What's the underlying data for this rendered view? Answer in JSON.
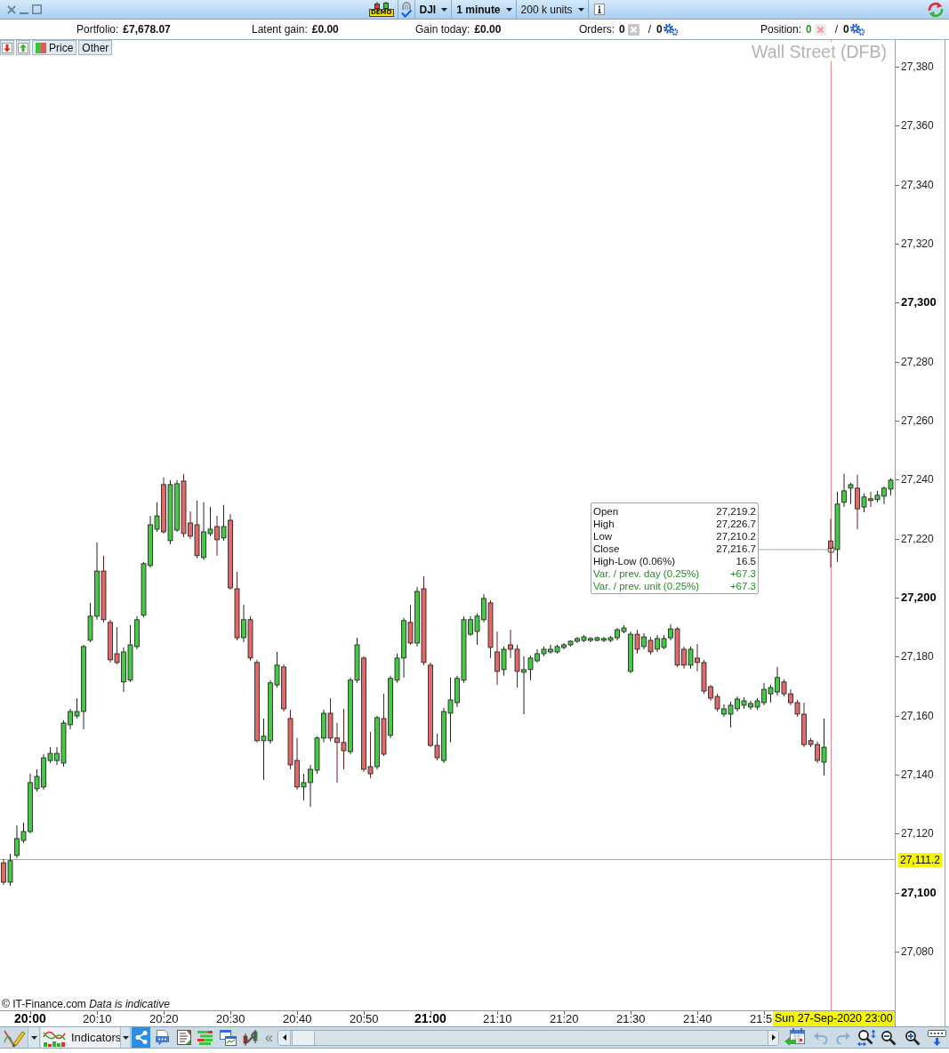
{
  "title_bar": {
    "account_badge": "DEMO",
    "instrument": "DJI",
    "interval": "1 minute",
    "trade_size": "200 k units"
  },
  "summary_bar": {
    "figures": [
      {
        "label": "Portfolio:",
        "value": "£7,678.07"
      },
      {
        "label": "Latent gain:",
        "value": "£0.00"
      },
      {
        "label": "Gain today:",
        "value": "£0.00"
      }
    ],
    "orders": {
      "label": "Orders:",
      "count": "0",
      "separator": "/",
      "pending": "0"
    },
    "position": {
      "label": "Position:",
      "count": "0",
      "separator": "/",
      "pending": "0"
    }
  },
  "chart": {
    "tabs": [
      {
        "label": "Price"
      },
      {
        "label": "Other"
      }
    ],
    "instrument_name": "Wall Street (DFB)",
    "chart_data": {
      "type": "candlestick",
      "ylim": [
        27060.1,
        27389.0
      ],
      "yticks": [
        {
          "value": 27380,
          "label": "27,380"
        },
        {
          "value": 27360,
          "label": "27,360"
        },
        {
          "value": 27340,
          "label": "27,340"
        },
        {
          "value": 27320,
          "label": "27,320"
        },
        {
          "value": 27300,
          "label": "27,300"
        },
        {
          "value": 27280,
          "label": "27,280"
        },
        {
          "value": 27260,
          "label": "27,260"
        },
        {
          "value": 27240,
          "label": "27,240"
        },
        {
          "value": 27220,
          "label": "27,220"
        },
        {
          "value": 27200,
          "label": "27,200"
        },
        {
          "value": 27180,
          "label": "27,180"
        },
        {
          "value": 27160,
          "label": "27,160"
        },
        {
          "value": 27140,
          "label": "27,140"
        },
        {
          "value": 27120,
          "label": "27,120"
        },
        {
          "value": 27100,
          "label": "27,100"
        },
        {
          "value": 27080,
          "label": "27,080"
        }
      ],
      "ref_lines": [
        {
          "axis": "y",
          "value": 27111.2,
          "label": "27,111.2"
        }
      ],
      "categories": [
        null,
        null,
        null,
        null,
        "20:00",
        null,
        null,
        null,
        null,
        null,
        null,
        null,
        null,
        null,
        "20:10",
        null,
        null,
        null,
        null,
        null,
        null,
        null,
        null,
        null,
        "20:20",
        null,
        null,
        null,
        null,
        null,
        null,
        null,
        null,
        null,
        "20:30",
        null,
        null,
        null,
        null,
        null,
        null,
        null,
        null,
        null,
        "20:40",
        null,
        null,
        null,
        null,
        null,
        null,
        null,
        null,
        null,
        "20:50",
        null,
        null,
        null,
        null,
        null,
        null,
        null,
        null,
        null,
        "21:00",
        null,
        null,
        null,
        null,
        null,
        null,
        null,
        null,
        null,
        "21:10",
        null,
        null,
        null,
        null,
        null,
        null,
        null,
        null,
        null,
        "21:20",
        null,
        null,
        null,
        null,
        null,
        null,
        null,
        null,
        null,
        "21:30",
        null,
        null,
        null,
        null,
        null,
        null,
        null,
        null,
        null,
        "21:40",
        null,
        null,
        null,
        null,
        null,
        null,
        null,
        null,
        null,
        "21:5",
        null,
        null,
        null,
        null,
        null,
        null,
        null,
        null,
        null,
        null,
        null,
        null,
        null,
        null,
        null,
        null,
        null,
        null,
        null
      ],
      "ohlc": [
        [
          27110.1,
          27111.4,
          27102.6,
          27103.5
        ],
        [
          27103.5,
          27113.2,
          27102.3,
          27110.8
        ],
        [
          27112.6,
          27122.8,
          27111.7,
          27118.3
        ],
        [
          27117.7,
          27123.7,
          27116.8,
          27120.7
        ],
        [
          27120.7,
          27140.3,
          27120.1,
          27137.3
        ],
        [
          27135.2,
          27141.8,
          27134.3,
          27139.4
        ],
        [
          27135.8,
          27146.9,
          27134.9,
          27145.7
        ],
        [
          27144.8,
          27149.3,
          27143.9,
          27147.2
        ],
        [
          27144.8,
          27149.3,
          27143.3,
          27147.2
        ],
        [
          27143.9,
          27158.4,
          27142.7,
          27157.5
        ],
        [
          27156.9,
          27162.3,
          27155.4,
          27161.4
        ],
        [
          27159.9,
          27165.9,
          27159.0,
          27161.4
        ],
        [
          27161.4,
          27184.0,
          27155.4,
          27183.4
        ],
        [
          27185.5,
          27198.2,
          27184.9,
          27193.7
        ],
        [
          27193.7,
          27218.7,
          27192.5,
          27209.0
        ],
        [
          27209.0,
          27214.2,
          27191.6,
          27192.5
        ],
        [
          27191.6,
          27192.5,
          27178.0,
          27178.9
        ],
        [
          27181.0,
          27190.0,
          27177.4,
          27178.0
        ],
        [
          27171.4,
          27183.1,
          27168.0,
          27181.6
        ],
        [
          27172.0,
          27190.6,
          27171.4,
          27184.0
        ],
        [
          27183.4,
          27193.7,
          27182.5,
          27192.5
        ],
        [
          27194.0,
          27212.1,
          27193.4,
          27211.5
        ],
        [
          27210.9,
          27227.7,
          27210.2,
          27224.7
        ],
        [
          27223.2,
          27232.3,
          27222.3,
          27227.7
        ],
        [
          27238.3,
          27240.7,
          27221.7,
          27222.3
        ],
        [
          27219.3,
          27239.8,
          27218.1,
          27238.3
        ],
        [
          27222.9,
          27239.8,
          27222.3,
          27238.6
        ],
        [
          27239.5,
          27241.9,
          27220.5,
          27221.7
        ],
        [
          27225.3,
          27229.2,
          27219.9,
          27220.8
        ],
        [
          27224.7,
          27232.9,
          27213.3,
          27214.2
        ],
        [
          27213.6,
          27232.3,
          27212.7,
          27222.3
        ],
        [
          27221.7,
          27230.7,
          27220.8,
          27223.2
        ],
        [
          27224.1,
          27227.7,
          27214.2,
          27219.6
        ],
        [
          27220.2,
          27231.4,
          27219.3,
          27224.1
        ],
        [
          27226.2,
          27228.3,
          27202.7,
          27203.3
        ],
        [
          27203.0,
          27208.7,
          27185.5,
          27186.4
        ],
        [
          27186.4,
          27197.6,
          27184.9,
          27192.5
        ],
        [
          27192.5,
          27193.7,
          27178.6,
          27179.5
        ],
        [
          27178.0,
          27178.9,
          27150.9,
          27151.5
        ],
        [
          27151.5,
          27159.0,
          27138.2,
          27153.0
        ],
        [
          27151.5,
          27172.0,
          27150.5,
          27171.1
        ],
        [
          27170.4,
          27181.6,
          27169.5,
          27177.1
        ],
        [
          27176.5,
          27177.4,
          27161.4,
          27162.3
        ],
        [
          27159.0,
          27162.0,
          27141.8,
          27143.3
        ],
        [
          27144.8,
          27152.4,
          27134.9,
          27135.8
        ],
        [
          27135.8,
          27140.3,
          27131.3,
          27137.3
        ],
        [
          27137.3,
          27143.3,
          27129.1,
          27141.8
        ],
        [
          27141.5,
          27153.0,
          27140.3,
          27152.4
        ],
        [
          27152.4,
          27162.0,
          27150.9,
          27160.8
        ],
        [
          27160.8,
          27165.9,
          27151.2,
          27152.4
        ],
        [
          27152.4,
          27157.5,
          27137.3,
          27150.9
        ],
        [
          27150.9,
          27162.3,
          27141.8,
          27148.1
        ],
        [
          27147.8,
          27172.9,
          27146.9,
          27172.0
        ],
        [
          27172.0,
          27186.4,
          27171.1,
          27184.0
        ],
        [
          27179.5,
          27180.1,
          27140.9,
          27141.8
        ],
        [
          27142.7,
          27154.5,
          27138.8,
          27140.3
        ],
        [
          27142.7,
          27159.9,
          27141.8,
          27159.3
        ],
        [
          27159.0,
          27167.4,
          27146.3,
          27146.9
        ],
        [
          27153.3,
          27173.5,
          27152.4,
          27172.6
        ],
        [
          27172.0,
          27181.0,
          27171.1,
          27179.5
        ],
        [
          27179.5,
          27193.1,
          27172.9,
          27192.2
        ],
        [
          27191.6,
          27197.6,
          27184.0,
          27184.6
        ],
        [
          27184.6,
          27203.6,
          27183.4,
          27202.1
        ],
        [
          27203.0,
          27207.2,
          27177.1,
          27178.0
        ],
        [
          27177.1,
          27178.0,
          27149.3,
          27149.9
        ],
        [
          27149.9,
          27153.9,
          27144.8,
          27145.7
        ],
        [
          27144.8,
          27162.6,
          27143.9,
          27161.4
        ],
        [
          27160.8,
          27172.9,
          27150.9,
          27165.3
        ],
        [
          27164.4,
          27173.5,
          27162.9,
          27172.6
        ],
        [
          27172.0,
          27193.7,
          27171.1,
          27192.5
        ],
        [
          27187.6,
          27193.7,
          27187.0,
          27192.5
        ],
        [
          27188.5,
          27194.6,
          27184.0,
          27193.7
        ],
        [
          27192.5,
          27201.2,
          27191.6,
          27199.7
        ],
        [
          27198.2,
          27199.1,
          27179.5,
          27183.1
        ],
        [
          27181.6,
          27188.5,
          27170.4,
          27175.0
        ],
        [
          27175.6,
          27183.4,
          27173.5,
          27182.5
        ],
        [
          27184.0,
          27189.1,
          27179.5,
          27182.5
        ],
        [
          27182.5,
          27184.0,
          27169.5,
          27175.0
        ],
        [
          27174.7,
          27180.1,
          27160.5,
          27175.6
        ],
        [
          27175.6,
          27180.4,
          27172.0,
          27179.5
        ],
        [
          27178.6,
          27182.5,
          27178.0,
          27181.0
        ],
        [
          27181.0,
          27183.4,
          27180.1,
          27182.5
        ],
        [
          27181.6,
          27184.0,
          27181.0,
          27182.5
        ],
        [
          27181.6,
          27184.0,
          27181.0,
          27183.4
        ],
        [
          27183.1,
          27184.6,
          27182.5,
          27184.0
        ],
        [
          27184.0,
          27185.5,
          27183.4,
          27185.2
        ],
        [
          27185.2,
          27186.7,
          27184.6,
          27186.1
        ],
        [
          27185.5,
          27187.3,
          27184.9,
          27186.7
        ],
        [
          27185.5,
          27186.7,
          27184.9,
          27186.1
        ],
        [
          27185.5,
          27186.7,
          27185.2,
          27186.4
        ],
        [
          27185.5,
          27186.7,
          27184.9,
          27186.1
        ],
        [
          27185.5,
          27187.0,
          27184.9,
          27186.4
        ],
        [
          27186.4,
          27189.7,
          27185.5,
          27189.1
        ],
        [
          27188.5,
          27190.6,
          27187.9,
          27189.7
        ],
        [
          27175.0,
          27188.5,
          27174.4,
          27187.6
        ],
        [
          27187.6,
          27189.1,
          27181.0,
          27182.5
        ],
        [
          27183.4,
          27187.9,
          27182.5,
          27186.7
        ],
        [
          27185.5,
          27186.7,
          27180.7,
          27181.6
        ],
        [
          27182.5,
          27187.3,
          27181.6,
          27186.1
        ],
        [
          27183.1,
          27187.3,
          27182.5,
          27186.1
        ],
        [
          27186.4,
          27191.0,
          27185.5,
          27189.4
        ],
        [
          27189.4,
          27190.0,
          27176.5,
          27177.1
        ],
        [
          27182.5,
          27183.4,
          27175.9,
          27177.1
        ],
        [
          27177.1,
          27183.4,
          27175.9,
          27182.5
        ],
        [
          27179.5,
          27184.3,
          27175.0,
          27178.0
        ],
        [
          27178.0,
          27178.9,
          27167.4,
          27168.3
        ],
        [
          27169.8,
          27170.4,
          27165.0,
          27165.9
        ],
        [
          27166.5,
          27167.4,
          27161.4,
          27162.3
        ],
        [
          27160.5,
          27163.8,
          27159.6,
          27162.3
        ],
        [
          27160.5,
          27164.7,
          27156.0,
          27163.5
        ],
        [
          27162.3,
          27166.5,
          27161.4,
          27165.6
        ],
        [
          27163.5,
          27166.2,
          27162.3,
          27165.0
        ],
        [
          27162.9,
          27165.0,
          27162.0,
          27164.1
        ],
        [
          27162.9,
          27165.9,
          27162.0,
          27165.0
        ],
        [
          27164.4,
          27171.1,
          27163.5,
          27168.9
        ],
        [
          27167.4,
          27170.4,
          27164.4,
          27169.5
        ],
        [
          27168.0,
          27176.5,
          27166.8,
          27172.9
        ],
        [
          27171.4,
          27172.3,
          27166.5,
          27167.4
        ],
        [
          27167.4,
          27168.9,
          27163.5,
          27164.4
        ],
        [
          27164.4,
          27165.3,
          27159.6,
          27160.5
        ],
        [
          27160.5,
          27164.4,
          27149.3,
          27150.2
        ],
        [
          27151.5,
          27152.4,
          27149.3,
          27150.2
        ],
        [
          27150.2,
          27151.2,
          27143.9,
          27144.8
        ],
        [
          27144.2,
          27159.0,
          27139.7,
          27149.3
        ],
        [
          27219.2,
          27226.7,
          27210.2,
          27216.7
        ],
        [
          27216.3,
          27235.9,
          27212.1,
          27231.7
        ],
        [
          27232.3,
          27241.9,
          27230.7,
          27236.2
        ],
        [
          27237.1,
          27238.9,
          27231.7,
          27238.3
        ],
        [
          27237.1,
          27241.6,
          27223.2,
          27230.1
        ],
        [
          27230.7,
          27235.3,
          27228.9,
          27234.1
        ],
        [
          27233.5,
          27235.9,
          27230.7,
          27232.9
        ],
        [
          27233.2,
          27236.2,
          27232.3,
          27234.7
        ],
        [
          27234.4,
          27237.7,
          27231.7,
          27237.1
        ],
        [
          27236.8,
          27240.4,
          27234.7,
          27239.8
        ]
      ]
    },
    "tooltip": [
      {
        "label": "Open",
        "value": "27,219.2",
        "kind": "plain"
      },
      {
        "label": "High",
        "value": "27,226.7",
        "kind": "plain"
      },
      {
        "label": "Low",
        "value": "27,210.2",
        "kind": "plain"
      },
      {
        "label": "Close",
        "value": "27,216.7",
        "kind": "plain"
      },
      {
        "label": "High-Low (0.06%)",
        "value": "16.5",
        "kind": "plain"
      },
      {
        "label": "Var. / prev. day (0.25%)",
        "value": "+67.3",
        "kind": "change"
      },
      {
        "label": "Var. / prev. unit (0.25%)",
        "value": "+67.3",
        "kind": "change"
      }
    ],
    "source_note": "© IT-Finance.com  *Data is indicative*",
    "cursor_time": "Sun 27-Sep-2020 23:00"
  },
  "toolbar": {
    "indicators": "Indicators",
    "collapse": "«",
    "undo": {
      "disabled": true
    },
    "redo": {
      "disabled": true
    }
  }
}
